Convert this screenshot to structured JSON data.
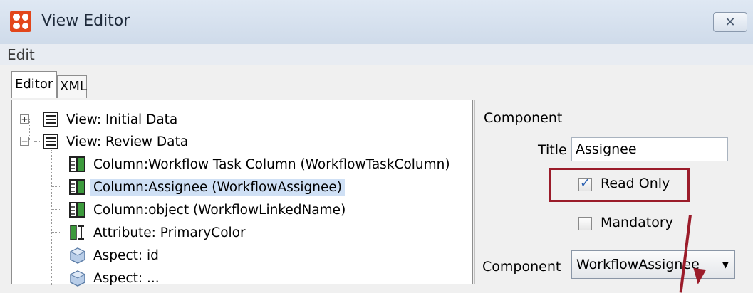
{
  "window": {
    "title": "View Editor",
    "close_glyph": "✕"
  },
  "menu": {
    "items": [
      "Edit"
    ]
  },
  "tabs": [
    {
      "label": "Editor",
      "active": true
    },
    {
      "label": "XML",
      "active": false
    }
  ],
  "tree": {
    "items": [
      {
        "label": "View: Initial Data",
        "icon": "table-icon",
        "expander": "+"
      },
      {
        "label": "View: Review Data",
        "icon": "table-icon",
        "expander": "−"
      },
      {
        "label": "Column:Workflow Task Column (WorkflowTaskColumn)",
        "icon": "column-icon"
      },
      {
        "label": "Column:Assignee (WorkflowAssignee)",
        "icon": "column-icon",
        "selected": true
      },
      {
        "label": "Column:object (WorkflowLinkedName)",
        "icon": "column-icon"
      },
      {
        "label": "Attribute: PrimaryColor",
        "icon": "attribute-icon"
      },
      {
        "label": "Aspect: id",
        "icon": "aspect-icon"
      },
      {
        "label": "Aspect: ...",
        "icon": "aspect-icon"
      }
    ]
  },
  "properties": {
    "section_title": "Component",
    "title_label": "Title",
    "title_value": "Assignee",
    "read_only_label": "Read Only",
    "read_only_checked": true,
    "mandatory_label": "Mandatory",
    "mandatory_checked": false,
    "component_label": "Component",
    "component_value": "WorkflowAssignee"
  },
  "colors": {
    "annotation": "#9b1c2a",
    "selection": "#cfe0f5",
    "app_icon": "#e2461b"
  }
}
